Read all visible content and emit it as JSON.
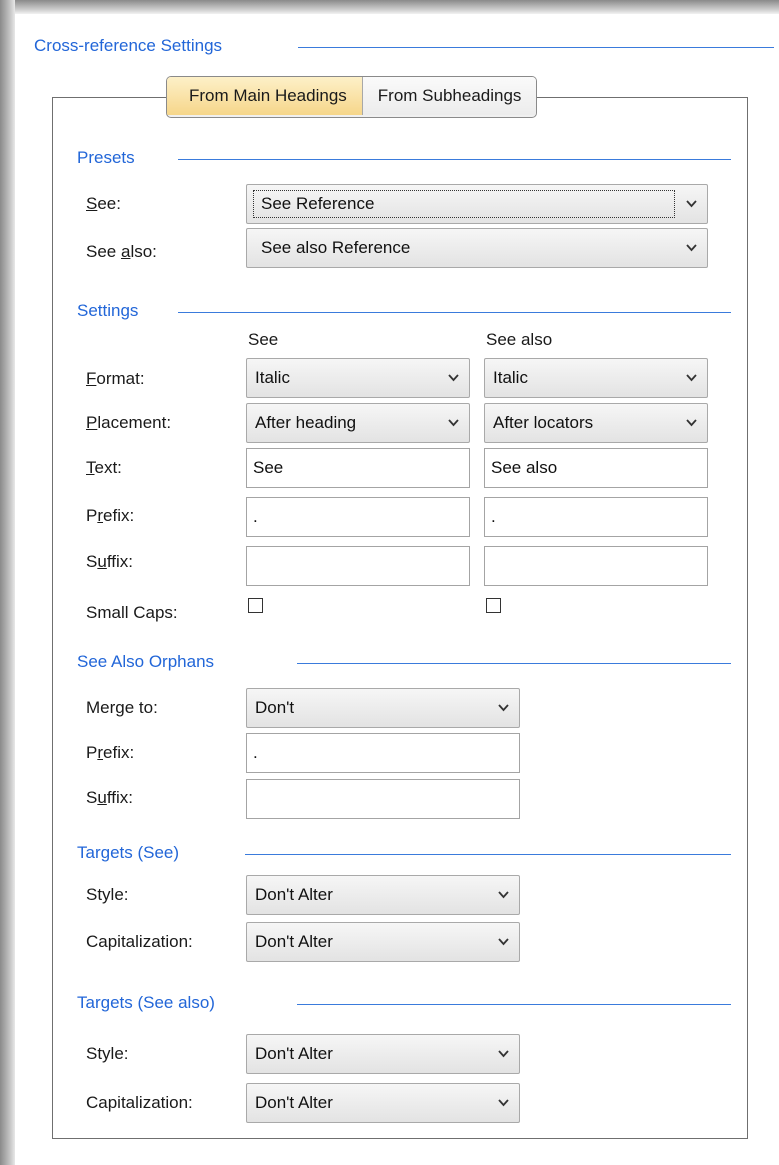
{
  "title": "Cross-reference Settings",
  "tabs": [
    {
      "label": "From Main Headings",
      "active": true
    },
    {
      "label": "From Subheadings",
      "active": false
    }
  ],
  "presets": {
    "header": "Presets",
    "see_label": "See:",
    "see_value": "See Reference",
    "see_also_label": "See also:",
    "see_also_value": "See also Reference"
  },
  "settings": {
    "header": "Settings",
    "col_see": "See",
    "col_see_also": "See also",
    "format_label": "Format:",
    "format_see": "Italic",
    "format_see_also": "Italic",
    "placement_label": "Placement:",
    "placement_see": "After heading",
    "placement_see_also": "After locators",
    "text_label": "Text:",
    "text_see": "See",
    "text_see_also": "See also",
    "prefix_label": "Prefix:",
    "prefix_see": ".",
    "prefix_see_also": ".",
    "suffix_label": "Suffix:",
    "suffix_see": "",
    "suffix_see_also": "",
    "smallcaps_label": "Small Caps:",
    "smallcaps_see": false,
    "smallcaps_see_also": false
  },
  "orphans": {
    "header": "See Also Orphans",
    "merge_label": "Merge to:",
    "merge_value": "Don't",
    "prefix_label": "Prefix:",
    "prefix_value": ".",
    "suffix_label": "Suffix:",
    "suffix_value": ""
  },
  "targets_see": {
    "header": "Targets (See)",
    "style_label": "Style:",
    "style_value": "Don't Alter",
    "cap_label": "Capitalization:",
    "cap_value": "Don't Alter"
  },
  "targets_see_also": {
    "header": "Targets (See also)",
    "style_label": "Style:",
    "style_value": "Don't Alter",
    "cap_label": "Capitalization:",
    "cap_value": "Don't Alter"
  },
  "colors": {
    "accent": "#2266d8",
    "tab_active": "#f6d68a"
  },
  "icons": {
    "dropdown": "chevron-down-icon"
  }
}
